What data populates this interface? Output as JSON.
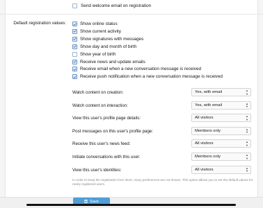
{
  "send_welcome_email": {
    "label": "Send welcome email on registration",
    "checked": false
  },
  "section_label": "Default registration values:",
  "checkbox_options": [
    {
      "label": "Show online status",
      "checked": true
    },
    {
      "label": "Show current activity",
      "checked": true
    },
    {
      "label": "Show signatures with messages",
      "checked": true
    },
    {
      "label": "Show day and month of birth",
      "checked": true
    },
    {
      "label": "Show year of birth",
      "checked": false
    },
    {
      "label": "Receive news and update emails",
      "checked": true
    },
    {
      "label": "Receive email when a new conversation message is received",
      "checked": true
    },
    {
      "label": "Receive push notification when a new conversation message is received",
      "checked": true
    }
  ],
  "select_options": [
    {
      "label": "Watch content on creation:",
      "value": "Yes, with email"
    },
    {
      "label": "Watch content on interaction:",
      "value": "Yes, with email"
    },
    {
      "label": "View this user's profile page details:",
      "value": "All visitors"
    },
    {
      "label": "Post messages on this user's profile page:",
      "value": "Members only"
    },
    {
      "label": "Receive this user's news feed:",
      "value": "All visitors"
    },
    {
      "label": "Initiate conversations with this user:",
      "value": "Members only"
    },
    {
      "label": "View this user's identities:",
      "value": "All visitors"
    }
  ],
  "note": "In order to keep the registration form short, many preferences are not shown. This option allows you to set the default values for newly registered users.",
  "save_label": "Save",
  "icons": {
    "checkbox": "check-icon",
    "save": "save-icon",
    "select": "select-arrows-icon"
  }
}
